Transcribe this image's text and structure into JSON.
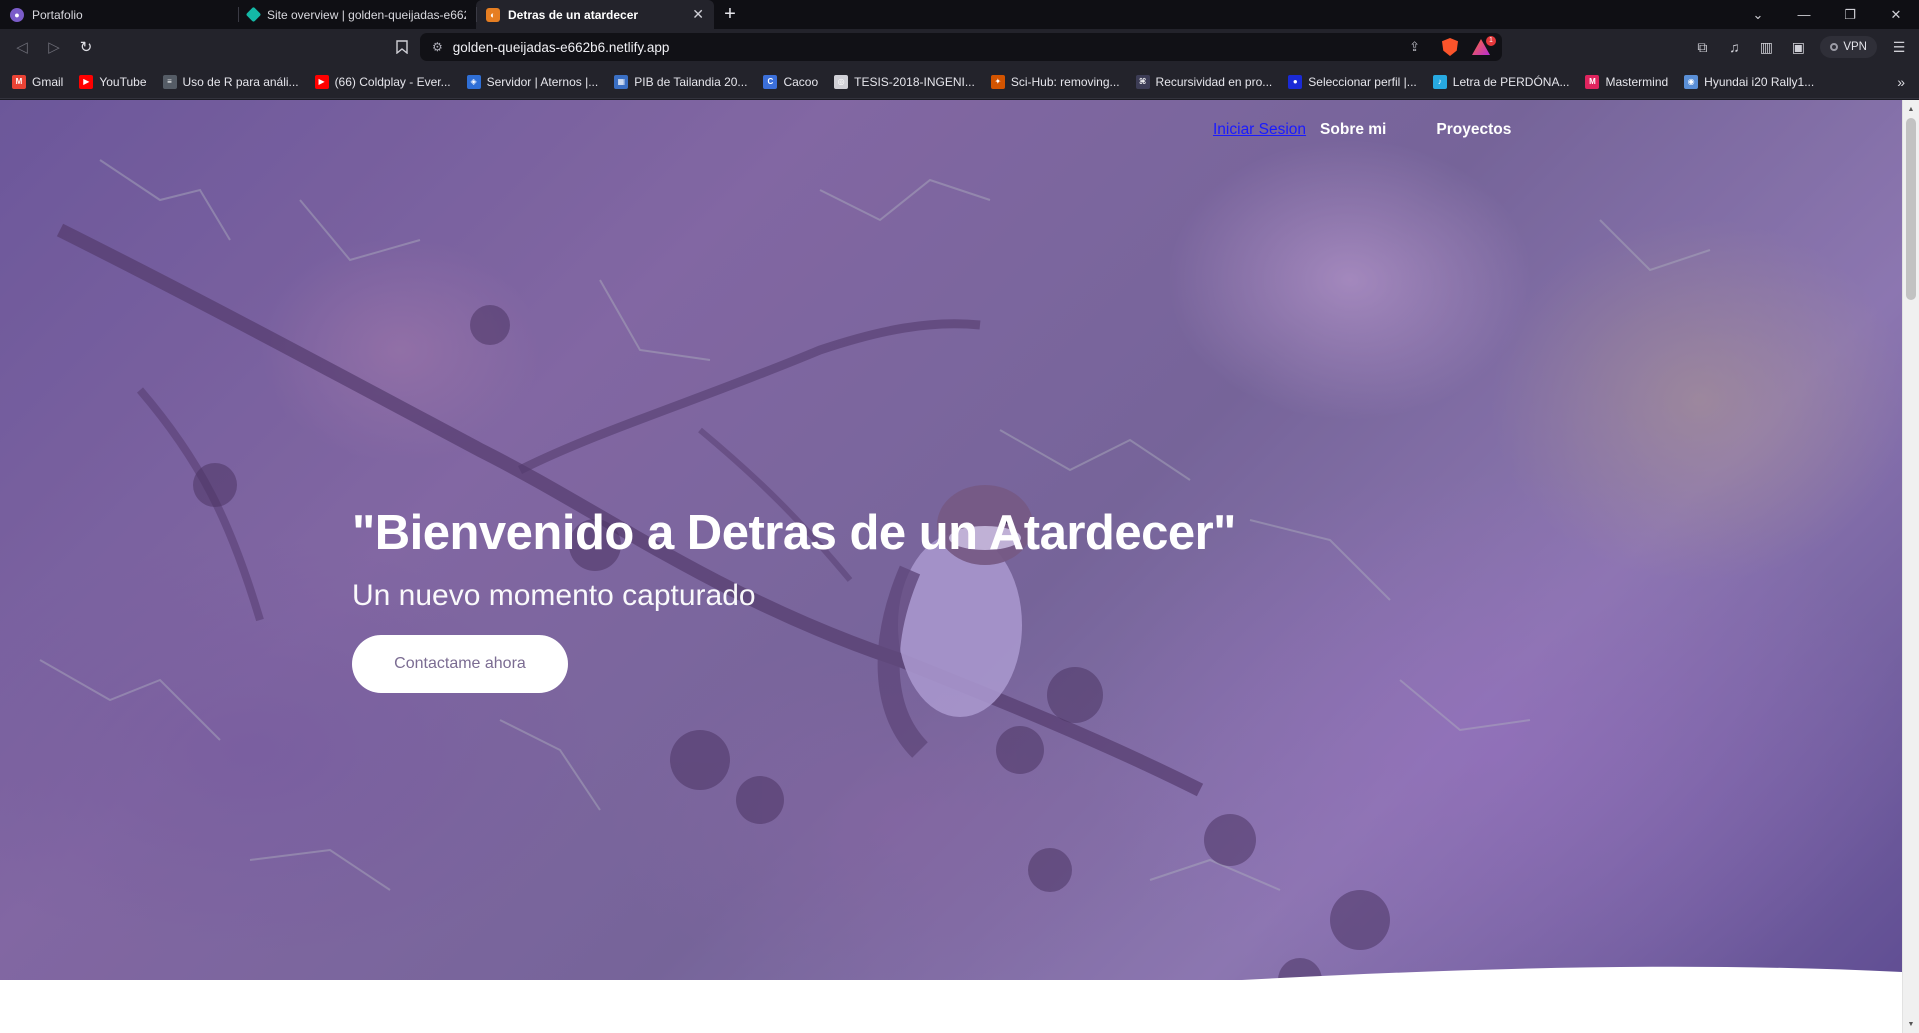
{
  "browser": {
    "tabs": [
      {
        "title": "Portafolio",
        "favicon": "portfolio-icon",
        "color": "#7b5cc9",
        "active": false
      },
      {
        "title": "Site overview | golden-queijadas-e662",
        "favicon": "netlify-icon",
        "color": "#14b8a6",
        "active": false
      },
      {
        "title": "Detras de un atardecer",
        "favicon": "sunset-icon",
        "color": "#e67e22",
        "active": true
      }
    ],
    "new_tab_label": "+",
    "url": "golden-queijadas-e662b6.netlify.app",
    "vpn_label": "VPN",
    "rewards_badge": "1"
  },
  "bookmarks": [
    {
      "label": "Gmail",
      "icon": "gmail-icon",
      "color": "#ea4335",
      "glyph": "M"
    },
    {
      "label": "YouTube",
      "icon": "youtube-icon",
      "color": "#ff0000",
      "glyph": "▶"
    },
    {
      "label": "Uso de R para análi...",
      "icon": "document-icon",
      "color": "#555c66",
      "glyph": "≡"
    },
    {
      "label": "(66) Coldplay - Ever...",
      "icon": "youtube-icon",
      "color": "#ff0000",
      "glyph": "▶"
    },
    {
      "label": "Servidor | Aternos |...",
      "icon": "aternos-icon",
      "color": "#2f6fd6",
      "glyph": "◈"
    },
    {
      "label": "PIB de Tailandia 20...",
      "icon": "chart-icon",
      "color": "#3a6fc4",
      "glyph": "▦"
    },
    {
      "label": "Cacoo",
      "icon": "cacoo-icon",
      "color": "#3b6fd9",
      "glyph": "C"
    },
    {
      "label": "TESIS-2018-INGENI...",
      "icon": "globe-icon",
      "color": "#d0d0d6",
      "glyph": "◎"
    },
    {
      "label": "Sci-Hub: removing...",
      "icon": "scihub-icon",
      "color": "#d35400",
      "glyph": "✦"
    },
    {
      "label": "Recursividad en pro...",
      "icon": "code-icon",
      "color": "#3c3c55",
      "glyph": "⌘"
    },
    {
      "label": "Seleccionar perfil |...",
      "icon": "profile-icon",
      "color": "#1a2ad6",
      "glyph": "●"
    },
    {
      "label": "Letra de PERDÓNA...",
      "icon": "lyrics-icon",
      "color": "#27a9e1",
      "glyph": "♪"
    },
    {
      "label": "Mastermind",
      "icon": "mastermind-icon",
      "color": "#e0245e",
      "glyph": "M"
    },
    {
      "label": "Hyundai i20 Rally1...",
      "icon": "globe-icon",
      "color": "#5a8fd6",
      "glyph": "◉"
    }
  ],
  "page": {
    "nav": {
      "login": "Iniciar Sesion",
      "about": "Sobre mi",
      "projects": "Proyectos"
    },
    "hero": {
      "title": "\"Bienvenido a Detras de un Atardecer\"",
      "subtitle": "Un nuevo momento capturado",
      "cta": "Contactame ahora"
    }
  },
  "colors": {
    "overlay": "#6e55b4",
    "cta_text": "#7b6c92",
    "login_link": "#1a1aff"
  }
}
